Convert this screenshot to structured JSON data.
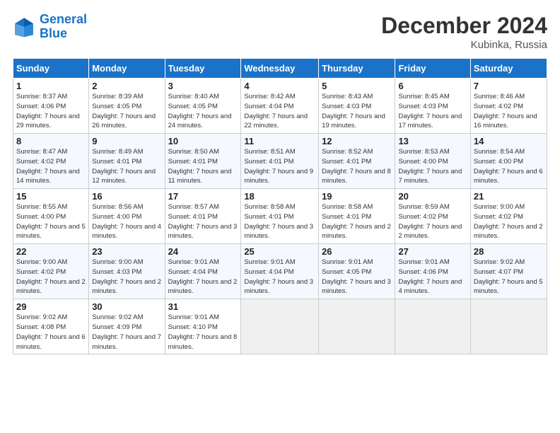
{
  "header": {
    "logo_line1": "General",
    "logo_line2": "Blue",
    "month": "December 2024",
    "location": "Kubinka, Russia"
  },
  "weekdays": [
    "Sunday",
    "Monday",
    "Tuesday",
    "Wednesday",
    "Thursday",
    "Friday",
    "Saturday"
  ],
  "weeks": [
    [
      {
        "day": "1",
        "info": "Sunrise: 8:37 AM\nSunset: 4:06 PM\nDaylight: 7 hours\nand 29 minutes."
      },
      {
        "day": "2",
        "info": "Sunrise: 8:39 AM\nSunset: 4:05 PM\nDaylight: 7 hours\nand 26 minutes."
      },
      {
        "day": "3",
        "info": "Sunrise: 8:40 AM\nSunset: 4:05 PM\nDaylight: 7 hours\nand 24 minutes."
      },
      {
        "day": "4",
        "info": "Sunrise: 8:42 AM\nSunset: 4:04 PM\nDaylight: 7 hours\nand 22 minutes."
      },
      {
        "day": "5",
        "info": "Sunrise: 8:43 AM\nSunset: 4:03 PM\nDaylight: 7 hours\nand 19 minutes."
      },
      {
        "day": "6",
        "info": "Sunrise: 8:45 AM\nSunset: 4:03 PM\nDaylight: 7 hours\nand 17 minutes."
      },
      {
        "day": "7",
        "info": "Sunrise: 8:46 AM\nSunset: 4:02 PM\nDaylight: 7 hours\nand 16 minutes."
      }
    ],
    [
      {
        "day": "8",
        "info": "Sunrise: 8:47 AM\nSunset: 4:02 PM\nDaylight: 7 hours\nand 14 minutes."
      },
      {
        "day": "9",
        "info": "Sunrise: 8:49 AM\nSunset: 4:01 PM\nDaylight: 7 hours\nand 12 minutes."
      },
      {
        "day": "10",
        "info": "Sunrise: 8:50 AM\nSunset: 4:01 PM\nDaylight: 7 hours\nand 11 minutes."
      },
      {
        "day": "11",
        "info": "Sunrise: 8:51 AM\nSunset: 4:01 PM\nDaylight: 7 hours\nand 9 minutes."
      },
      {
        "day": "12",
        "info": "Sunrise: 8:52 AM\nSunset: 4:01 PM\nDaylight: 7 hours\nand 8 minutes."
      },
      {
        "day": "13",
        "info": "Sunrise: 8:53 AM\nSunset: 4:00 PM\nDaylight: 7 hours\nand 7 minutes."
      },
      {
        "day": "14",
        "info": "Sunrise: 8:54 AM\nSunset: 4:00 PM\nDaylight: 7 hours\nand 6 minutes."
      }
    ],
    [
      {
        "day": "15",
        "info": "Sunrise: 8:55 AM\nSunset: 4:00 PM\nDaylight: 7 hours\nand 5 minutes."
      },
      {
        "day": "16",
        "info": "Sunrise: 8:56 AM\nSunset: 4:00 PM\nDaylight: 7 hours\nand 4 minutes."
      },
      {
        "day": "17",
        "info": "Sunrise: 8:57 AM\nSunset: 4:01 PM\nDaylight: 7 hours\nand 3 minutes."
      },
      {
        "day": "18",
        "info": "Sunrise: 8:58 AM\nSunset: 4:01 PM\nDaylight: 7 hours\nand 3 minutes."
      },
      {
        "day": "19",
        "info": "Sunrise: 8:58 AM\nSunset: 4:01 PM\nDaylight: 7 hours\nand 2 minutes."
      },
      {
        "day": "20",
        "info": "Sunrise: 8:59 AM\nSunset: 4:02 PM\nDaylight: 7 hours\nand 2 minutes."
      },
      {
        "day": "21",
        "info": "Sunrise: 9:00 AM\nSunset: 4:02 PM\nDaylight: 7 hours\nand 2 minutes."
      }
    ],
    [
      {
        "day": "22",
        "info": "Sunrise: 9:00 AM\nSunset: 4:02 PM\nDaylight: 7 hours\nand 2 minutes."
      },
      {
        "day": "23",
        "info": "Sunrise: 9:00 AM\nSunset: 4:03 PM\nDaylight: 7 hours\nand 2 minutes."
      },
      {
        "day": "24",
        "info": "Sunrise: 9:01 AM\nSunset: 4:04 PM\nDaylight: 7 hours\nand 2 minutes."
      },
      {
        "day": "25",
        "info": "Sunrise: 9:01 AM\nSunset: 4:04 PM\nDaylight: 7 hours\nand 3 minutes."
      },
      {
        "day": "26",
        "info": "Sunrise: 9:01 AM\nSunset: 4:05 PM\nDaylight: 7 hours\nand 3 minutes."
      },
      {
        "day": "27",
        "info": "Sunrise: 9:01 AM\nSunset: 4:06 PM\nDaylight: 7 hours\nand 4 minutes."
      },
      {
        "day": "28",
        "info": "Sunrise: 9:02 AM\nSunset: 4:07 PM\nDaylight: 7 hours\nand 5 minutes."
      }
    ],
    [
      {
        "day": "29",
        "info": "Sunrise: 9:02 AM\nSunset: 4:08 PM\nDaylight: 7 hours\nand 6 minutes."
      },
      {
        "day": "30",
        "info": "Sunrise: 9:02 AM\nSunset: 4:09 PM\nDaylight: 7 hours\nand 7 minutes."
      },
      {
        "day": "31",
        "info": "Sunrise: 9:01 AM\nSunset: 4:10 PM\nDaylight: 7 hours\nand 8 minutes."
      },
      null,
      null,
      null,
      null
    ]
  ]
}
